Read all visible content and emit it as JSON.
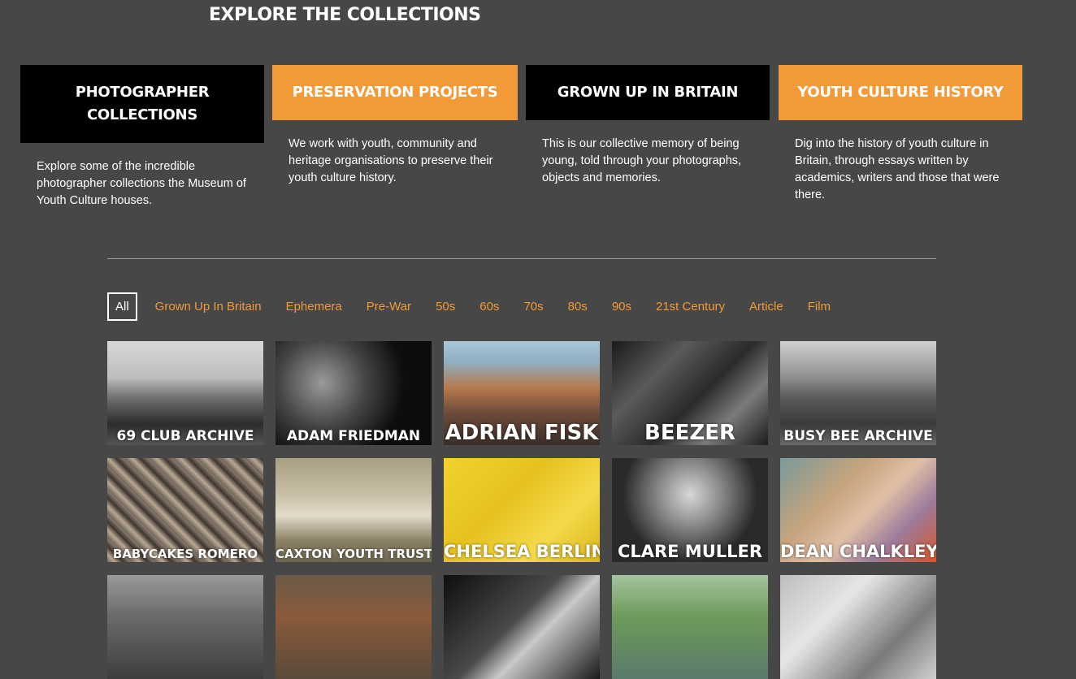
{
  "page": {
    "title": "EXPLORE THE COLLECTIONS"
  },
  "cards": [
    {
      "title": "PHOTOGRAPHER COLLECTIONS",
      "description": "Explore some of the incredible photographer collections the Museum of Youth Culture houses."
    },
    {
      "title": "PRESERVATION PROJECTS",
      "description": "We work with youth, community and heritage organisations to preserve their youth culture history."
    },
    {
      "title": "GROWN UP IN BRITAIN",
      "description": "This is our collective memory of being young, told through your photographs, objects and memories."
    },
    {
      "title": "YOUTH CULTURE HISTORY",
      "description": "Dig into the history of youth culture in Britain, through essays written by academics, writers and those that were there."
    }
  ],
  "filters": [
    "All",
    "Grown Up In Britain",
    "Ephemera",
    "Pre-War",
    "50s",
    "60s",
    "70s",
    "80s",
    "90s",
    "21st Century",
    "Article",
    "Film"
  ],
  "filter_active": "All",
  "collections": [
    {
      "label": "69 CLUB ARCHIVE"
    },
    {
      "label": "ADAM FRIEDMAN"
    },
    {
      "label": "ADRIAN FISK"
    },
    {
      "label": "BEEZER"
    },
    {
      "label": "BUSY BEE ARCHIVE"
    },
    {
      "label": "BABYCAKES ROMERO"
    },
    {
      "label": "CAXTON YOUTH TRUST"
    },
    {
      "label": "CHELSEA BERLIN"
    },
    {
      "label": "CLARE MULLER"
    },
    {
      "label": "DEAN CHALKLEY"
    },
    {
      "label": ""
    },
    {
      "label": ""
    },
    {
      "label": ""
    },
    {
      "label": ""
    },
    {
      "label": ""
    }
  ],
  "colors": {
    "background": "#464746",
    "accent": "#f29a38",
    "black": "#000000"
  }
}
